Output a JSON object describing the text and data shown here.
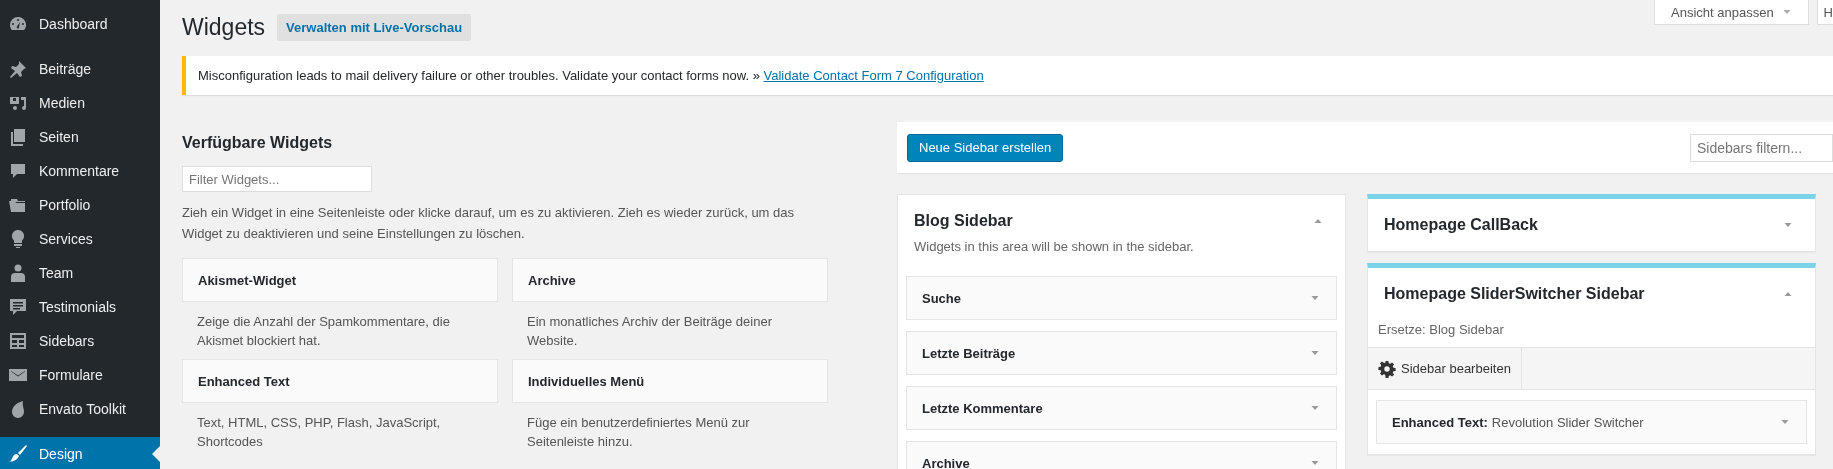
{
  "admin_menu": {
    "groups": [
      [
        {
          "label": "Dashboard",
          "selected": false
        }
      ],
      [
        {
          "label": "Beiträge",
          "selected": false
        },
        {
          "label": "Medien",
          "selected": false
        },
        {
          "label": "Seiten",
          "selected": false
        },
        {
          "label": "Kommentare",
          "selected": false
        },
        {
          "label": "Portfolio",
          "selected": false
        },
        {
          "label": "Services",
          "selected": false
        },
        {
          "label": "Team",
          "selected": false
        },
        {
          "label": "Testimonials",
          "selected": false
        },
        {
          "label": "Sidebars",
          "selected": false
        },
        {
          "label": "Formulare",
          "selected": false
        },
        {
          "label": "Envato Toolkit",
          "selected": false
        }
      ],
      [
        {
          "label": "Design",
          "selected": true
        }
      ]
    ]
  },
  "screen_buttons": [
    {
      "label": "Ansicht anpassen",
      "kind": "dropdown"
    },
    {
      "label": "H",
      "kind": "button"
    }
  ],
  "page": {
    "title": "Widgets",
    "live_preview_button": "Verwalten mit Live-Vorschau"
  },
  "notice": {
    "text": "Misconfiguration leads to mail delivery failure or other troubles. Validate your contact forms now. »",
    "link": "Validate Contact Form 7 Configuration"
  },
  "available_widgets": {
    "heading": "Verfügbare Widgets",
    "filter": {
      "placeholder": "Filter Widgets..."
    },
    "hint": "Zieh ein Widget in eine Seitenleiste oder klicke darauf, um es zu aktivieren. Zieh es wieder zurück, um das Widget zu deaktivieren und seine Einstellungen zu löschen.",
    "widgets": [
      {
        "title": "Akismet-Widget",
        "description": "Zeige die Anzahl der Spamkommentare, die Akismet blockiert hat."
      },
      {
        "title": "Archive",
        "description": "Ein monatliches Archiv der Beiträge deiner Website."
      },
      {
        "title": "Enhanced Text",
        "description": "Text, HTML, CSS, PHP, Flash, JavaScript, Shortcodes"
      },
      {
        "title": "Individuelles Menü",
        "description": "Füge ein benutzerdefiniertes Menü zur Seitenleiste hinzu."
      }
    ]
  },
  "sidebar_toolbar": {
    "create_button": "Neue Sidebar erstellen",
    "filter": {
      "placeholder": "Sidebars filtern..."
    }
  },
  "sidebar_columns": [
    [
      {
        "title": "Blog Sidebar",
        "kind": "default",
        "expanded": true,
        "description": "Widgets in this area will be shown in the sidebar.",
        "widgets": [
          {
            "title": "Suche",
            "expanded": false
          },
          {
            "title": "Letzte Beiträge",
            "expanded": false
          },
          {
            "title": "Letzte Kommentare",
            "expanded": false
          },
          {
            "title": "Archive",
            "expanded": false
          }
        ]
      }
    ],
    [
      {
        "title": "Homepage CallBack",
        "kind": "custom",
        "expanded": false
      },
      {
        "title": "Homepage SliderSwitcher Sidebar",
        "kind": "custom",
        "expanded": true,
        "replaces_note": "Ersetze: Blog Sidebar",
        "edit_button": "Sidebar bearbeiten",
        "widgets": [
          {
            "title": "Enhanced Text:",
            "subtitle": "Revolution Slider Switcher",
            "expanded": false
          }
        ]
      }
    ]
  ]
}
